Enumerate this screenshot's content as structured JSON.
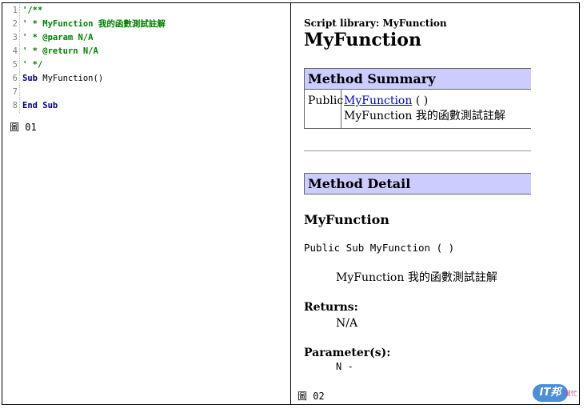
{
  "left": {
    "code_lines": [
      {
        "num": "1",
        "text": "'/**",
        "style": "cmt"
      },
      {
        "num": "2",
        "text": "' * MyFunction 我的函數測試註解",
        "style": "cmt"
      },
      {
        "num": "3",
        "text": "' * @param N/A",
        "style": "cmt"
      },
      {
        "num": "4",
        "text": "' * @return N/A",
        "style": "cmt"
      },
      {
        "num": "5",
        "text": "' */",
        "style": "cmt"
      },
      {
        "num": "6",
        "kw": "Sub",
        "text": " MyFunction()",
        "style": "mixed"
      },
      {
        "num": "7",
        "text": "",
        "style": "plain"
      },
      {
        "num": "8",
        "text": "End Sub",
        "style": "kw"
      }
    ],
    "caption": "圖 01"
  },
  "right": {
    "library_label": "Script library: MyFunction",
    "title": "MyFunction",
    "method_summary_header": "Method Summary",
    "summary": {
      "modifier": "Public",
      "link_text": "MyFunction",
      "params": " ( )",
      "description": "MyFunction 我的函數測試註解"
    },
    "method_detail_header": "Method Detail",
    "detail_name": "MyFunction",
    "signature": "Public Sub MyFunction ( )",
    "description": "MyFunction 我的函數測試註解",
    "returns_label": "Returns:",
    "returns_value": "N/A",
    "parameters_label": "Parameter(s):",
    "parameters_value": "N -",
    "caption": "圖 02"
  },
  "watermark": {
    "logo_text": "IT邦",
    "sub_text": "幫忙"
  }
}
